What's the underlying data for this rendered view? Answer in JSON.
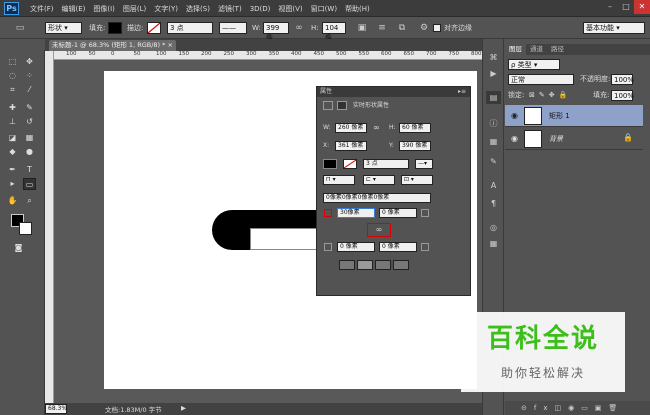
{
  "app": {
    "logo": "Ps",
    "menus": [
      "文件(F)",
      "编辑(E)",
      "图像(I)",
      "图层(L)",
      "文字(Y)",
      "选择(S)",
      "滤镜(T)",
      "3D(D)",
      "视图(V)",
      "窗口(W)",
      "帮助(H)"
    ]
  },
  "options": {
    "mode": "形状",
    "fill_label": "填充:",
    "stroke_label": "描边:",
    "stroke_width": "3 点",
    "w_label": "W:",
    "w_value": "399 像",
    "h_label": "H:",
    "h_value": "104 像",
    "align_edges": "对齐边缘",
    "workspace": "基本功能"
  },
  "doc_tab": "未标题-1 @ 68.3% (矩形 1, RGB/8) *",
  "ruler": {
    "top": [
      "100",
      "50",
      "0",
      "50",
      "100",
      "150",
      "200",
      "250",
      "300",
      "350",
      "400",
      "450",
      "500",
      "550",
      "600",
      "650",
      "700",
      "750",
      "800"
    ]
  },
  "status": {
    "zoom": "68.3%",
    "doc_info": "文档:1.83M/0 字节"
  },
  "properties": {
    "header": "属性",
    "title": "实时形状属性",
    "w_label": "W:",
    "w_value": "260 像素",
    "h_label": "H:",
    "h_value": "60 像素",
    "x_label": "X:",
    "x_value": "361 像素",
    "y_label": "Y:",
    "y_value": "390 像素",
    "stroke_width": "3 点",
    "corners_all": "0像素0像素0像素0像素",
    "tl": "30像素",
    "tr": "0 像素",
    "bl": "0 像素",
    "br": "0 像素"
  },
  "layers": {
    "tabs": [
      "图层",
      "通道",
      "路径"
    ],
    "kind": "ρ 类型",
    "blend": "正常",
    "opacity_label": "不透明度:",
    "opacity": "100%",
    "lock_label": "锁定:",
    "fill_label": "填充:",
    "fill": "100%",
    "items": [
      {
        "name": "矩形 1"
      },
      {
        "name": "背景"
      }
    ]
  },
  "watermark": {
    "title": "百科全说",
    "subtitle": "助你轻松解决"
  },
  "colors": {
    "accent": "#3cbf1a",
    "panel": "#535353",
    "selected_layer": "#8ea2c9"
  }
}
